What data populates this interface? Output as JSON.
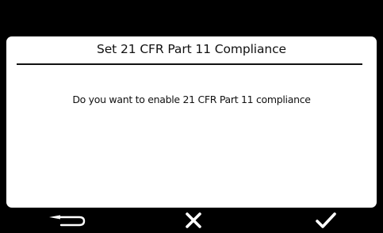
{
  "dialog": {
    "title": "Set 21 CFR Part 11 Compliance",
    "message": "Do you want to enable 21 CFR Part 11 compliance"
  },
  "softkeys": [
    {
      "action": "back",
      "icon": "back-arrow-icon"
    },
    {
      "action": "cancel",
      "icon": "close-icon"
    },
    {
      "action": "confirm",
      "icon": "checkmark-icon"
    }
  ],
  "colors": {
    "background": "#000000",
    "dialog": "#ffffff",
    "text": "#111111",
    "softkey_icon": "#ffffff"
  }
}
